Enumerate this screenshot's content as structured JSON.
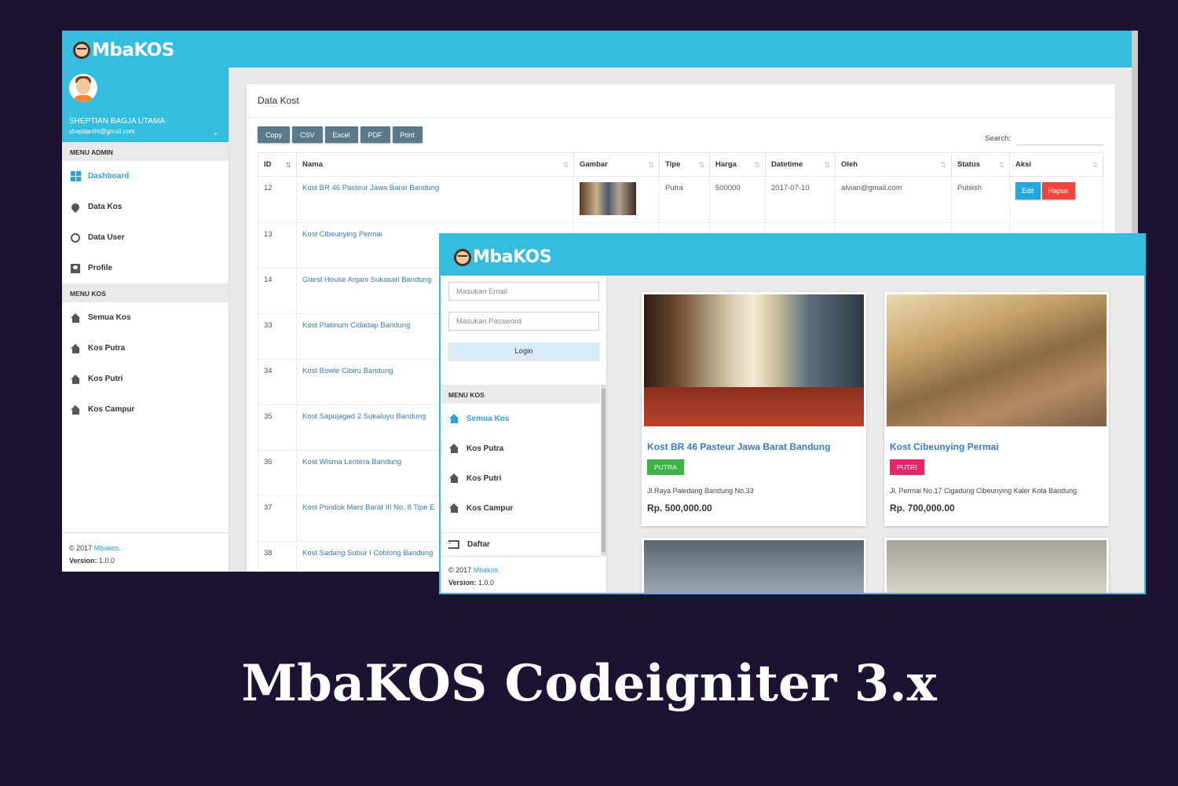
{
  "brand": {
    "logo_text": "MbaKOS",
    "accent": "#35bde0",
    "link_color": "#3a7bc0"
  },
  "admin": {
    "user": {
      "name": "SHEPTIAN BAGJA UTAMA",
      "email": "sheptian96@gmail.com"
    },
    "menu_admin_label": "MENU ADMIN",
    "admin_items": [
      {
        "label": "Dashboard",
        "icon": "dashboard-icon"
      },
      {
        "label": "Data Kos",
        "icon": "map-pin-icon"
      },
      {
        "label": "Data User",
        "icon": "user-face-icon"
      },
      {
        "label": "Profile",
        "icon": "profile-card-icon"
      }
    ],
    "menu_kos_label": "MENU KOS",
    "kos_items": [
      {
        "label": "Semua Kos",
        "icon": "home-icon"
      },
      {
        "label": "Kos Putra",
        "icon": "home-icon"
      },
      {
        "label": "Kos Putri",
        "icon": "home-icon"
      },
      {
        "label": "Kos Campur",
        "icon": "home-icon"
      }
    ],
    "footer": {
      "copyright": "© 2017",
      "brand": "Mbakos.",
      "version_label": "Version:",
      "version": "1.0.0"
    },
    "card_title": "Data Kost",
    "toolbar": [
      "Copy",
      "CSV",
      "Excel",
      "PDF",
      "Print"
    ],
    "search_label": "Search:",
    "columns": [
      "ID",
      "Nama",
      "Gambar",
      "Tipe",
      "Harga",
      "Datetime",
      "Oleh",
      "Status",
      "Aksi"
    ],
    "rows": [
      {
        "id": "12",
        "nama": "Kost BR 46 Pasteur Jawa Barat Bandung",
        "tipe": "Putra",
        "harga": "500000",
        "datetime": "2017-07-10",
        "oleh": "alvian@gmail.com",
        "status": "Publish"
      },
      {
        "id": "13",
        "nama": "Kost Cibeunying Permai"
      },
      {
        "id": "14",
        "nama": "Guest House Anjani Sukasari Bandung"
      },
      {
        "id": "33",
        "nama": "Kost Platinum Cidadap Bandung"
      },
      {
        "id": "34",
        "nama": "Kost Bowie Cibiru Bandung"
      },
      {
        "id": "35",
        "nama": "Kost Sapujagad 2 Sukaluyu Bandung"
      },
      {
        "id": "36",
        "nama": "Kost Wisma Lentera Bandung"
      },
      {
        "id": "37",
        "nama": "Kost Pondok Mars Barat III No. 8 Tipe E"
      },
      {
        "id": "38",
        "nama": "Kost Sadang Subur I Coblong Bandung"
      }
    ],
    "edit_label": "Edit",
    "hapus_label": "Hapus"
  },
  "public": {
    "email_placeholder": "Masukan Email",
    "password_placeholder": "Masukan Password",
    "login_label": "Login",
    "menu_kos_label": "MENU KOS",
    "menu_items": [
      "Semua Kos",
      "Kos Putra",
      "Kos Putri",
      "Kos Campur"
    ],
    "daftar_label": "Daftar",
    "footer": {
      "copyright": "© 2017",
      "brand": "Mbakos.",
      "version_label": "Version:",
      "version": "1.0.0"
    },
    "cards": [
      {
        "name": "Kost BR 46 Pasteur Jawa Barat Bandung",
        "badge": "PUTRA",
        "badge_color": "#3cb34a",
        "address": "Jl.Raya Paledang Bandung No.33",
        "price": "Rp. 500,000.00"
      },
      {
        "name": "Kost Cibeunying Permai",
        "badge": "PUTRI",
        "badge_color": "#e8246a",
        "address": "Jl. Permai No.17 Cigadung Cibeunying Kaler Kota Bandung",
        "price": "Rp. 700,000.00"
      }
    ]
  },
  "title": "MbaKOS Codeigniter 3.x"
}
